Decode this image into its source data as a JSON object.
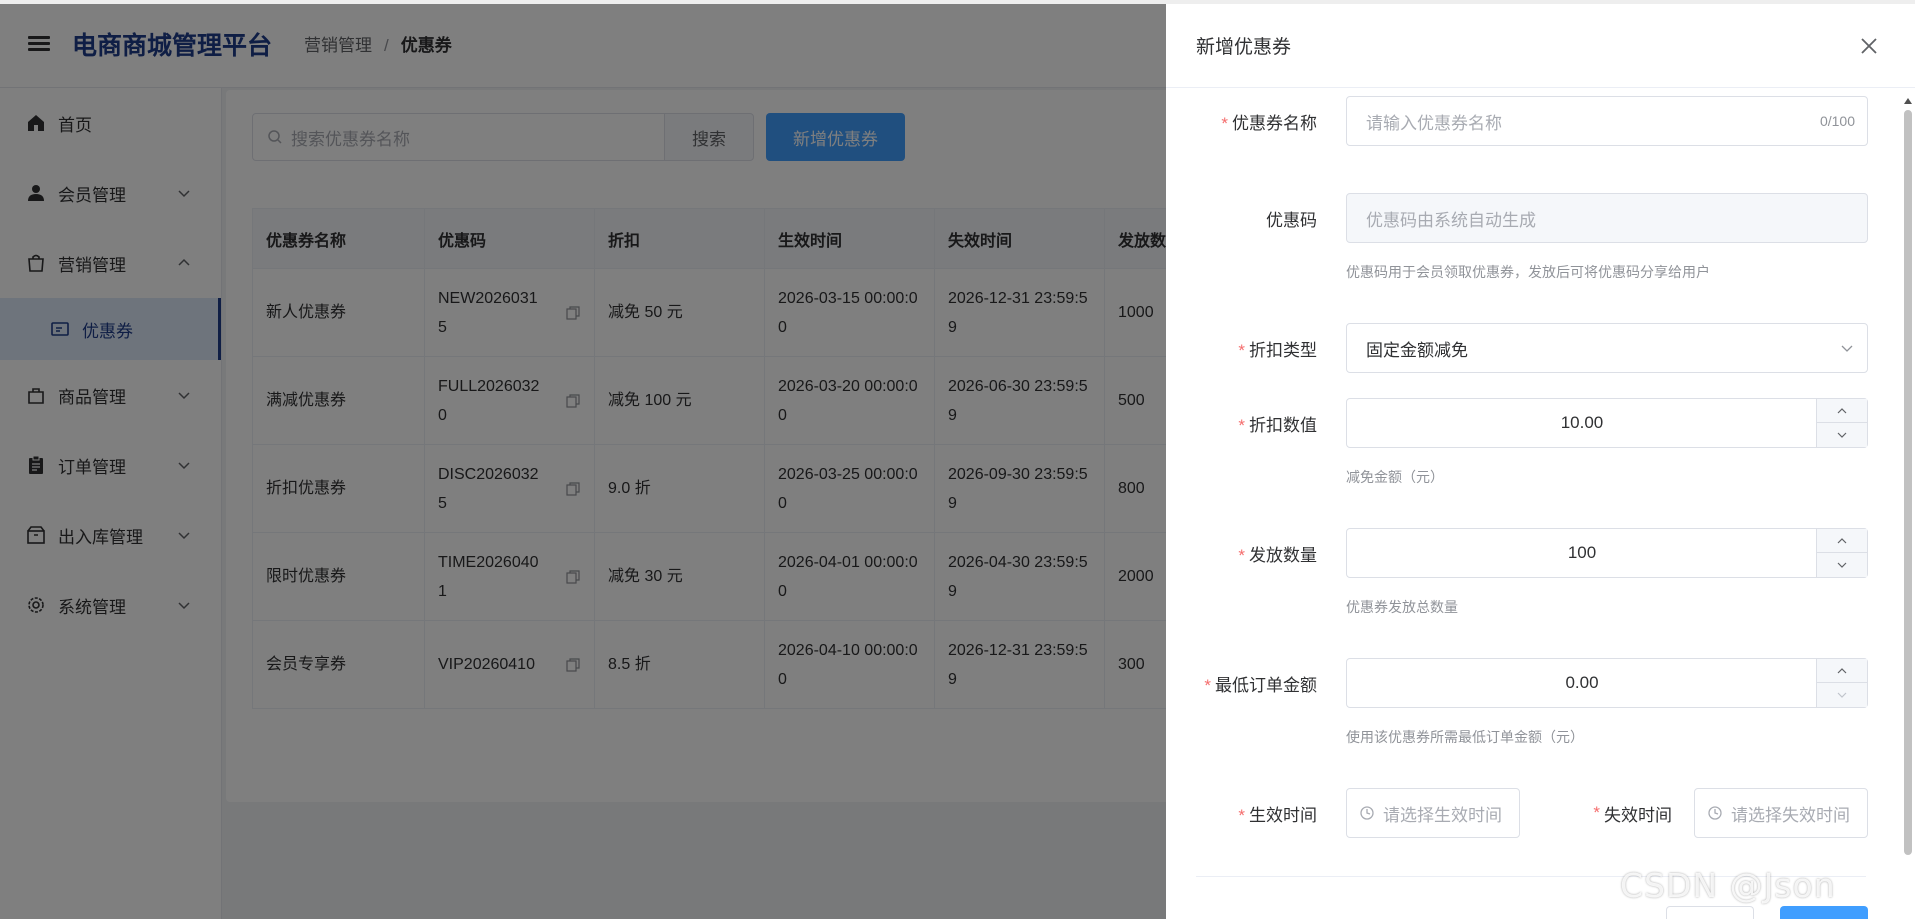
{
  "header": {
    "title": "电商商城管理平台",
    "breadcrumb": [
      "营销管理",
      "优惠券"
    ]
  },
  "sidebar": {
    "items": [
      {
        "label": "首页",
        "icon": "home-icon"
      },
      {
        "label": "会员管理",
        "icon": "user-icon"
      },
      {
        "label": "营销管理",
        "icon": "shopping-bag-icon"
      },
      {
        "label": "优惠券",
        "icon": "ticket-icon",
        "active": true
      },
      {
        "label": "商品管理",
        "icon": "bag-icon"
      },
      {
        "label": "订单管理",
        "icon": "clipboard-icon"
      },
      {
        "label": "出入库管理",
        "icon": "box-icon"
      },
      {
        "label": "系统管理",
        "icon": "gear-icon"
      }
    ]
  },
  "toolbar": {
    "search_placeholder": "搜索优惠券名称",
    "search_button": "搜索",
    "add_button": "新增优惠券"
  },
  "table": {
    "columns": [
      "优惠券名称",
      "优惠码",
      "折扣",
      "生效时间",
      "失效时间",
      "发放数"
    ],
    "rows": [
      {
        "name": "新人优惠券",
        "code_l1": "NEW2026031",
        "code_l2": "5",
        "discount": "减免 50 元",
        "start_l1": "2026-03-15 00:00:0",
        "start_l2": "0",
        "end_l1": "2026-12-31 23:59:5",
        "end_l2": "9",
        "qty": "1000"
      },
      {
        "name": "满减优惠券",
        "code_l1": "FULL2026032",
        "code_l2": "0",
        "discount": "减免 100 元",
        "start_l1": "2026-03-20 00:00:0",
        "start_l2": "0",
        "end_l1": "2026-06-30 23:59:5",
        "end_l2": "9",
        "qty": "500"
      },
      {
        "name": "折扣优惠券",
        "code_l1": "DISC2026032",
        "code_l2": "5",
        "discount": "9.0 折",
        "start_l1": "2026-03-25 00:00:0",
        "start_l2": "0",
        "end_l1": "2026-09-30 23:59:5",
        "end_l2": "9",
        "qty": "800"
      },
      {
        "name": "限时优惠券",
        "code_l1": "TIME2026040",
        "code_l2": "1",
        "discount": "减免 30 元",
        "start_l1": "2026-04-01 00:00:0",
        "start_l2": "0",
        "end_l1": "2026-04-30 23:59:5",
        "end_l2": "9",
        "qty": "2000"
      },
      {
        "name": "会员专享券",
        "code_l1": "VIP20260410",
        "code_l2": "",
        "discount": "8.5 折",
        "start_l1": "2026-04-10 00:00:0",
        "start_l2": "0",
        "end_l1": "2026-12-31 23:59:5",
        "end_l2": "9",
        "qty": "300"
      }
    ]
  },
  "drawer": {
    "title": "新增优惠券",
    "name": {
      "label": "优惠券名称",
      "placeholder": "请输入优惠券名称",
      "count": "0/100"
    },
    "code": {
      "label": "优惠码",
      "placeholder": "优惠码由系统自动生成",
      "hint": "优惠码用于会员领取优惠券，发放后可将优惠码分享给用户"
    },
    "type": {
      "label": "折扣类型",
      "value": "固定金额减免"
    },
    "amount": {
      "label": "折扣数值",
      "value": "10.00",
      "hint": "减免金额（元）"
    },
    "qty": {
      "label": "发放数量",
      "value": "100",
      "hint": "优惠券发放总数量"
    },
    "min": {
      "label": "最低订单金额",
      "value": "0.00",
      "hint": "使用该优惠券所需最低订单金额（元）"
    },
    "start": {
      "label": "生效时间",
      "placeholder": "请选择生效时间"
    },
    "end": {
      "label": "失效时间",
      "placeholder": "请选择失效时间"
    }
  },
  "watermark": "CSDN @Json",
  "colors": {
    "brand": "#1f3c8a",
    "primary": "#409eff",
    "required": "#f56c6c"
  }
}
